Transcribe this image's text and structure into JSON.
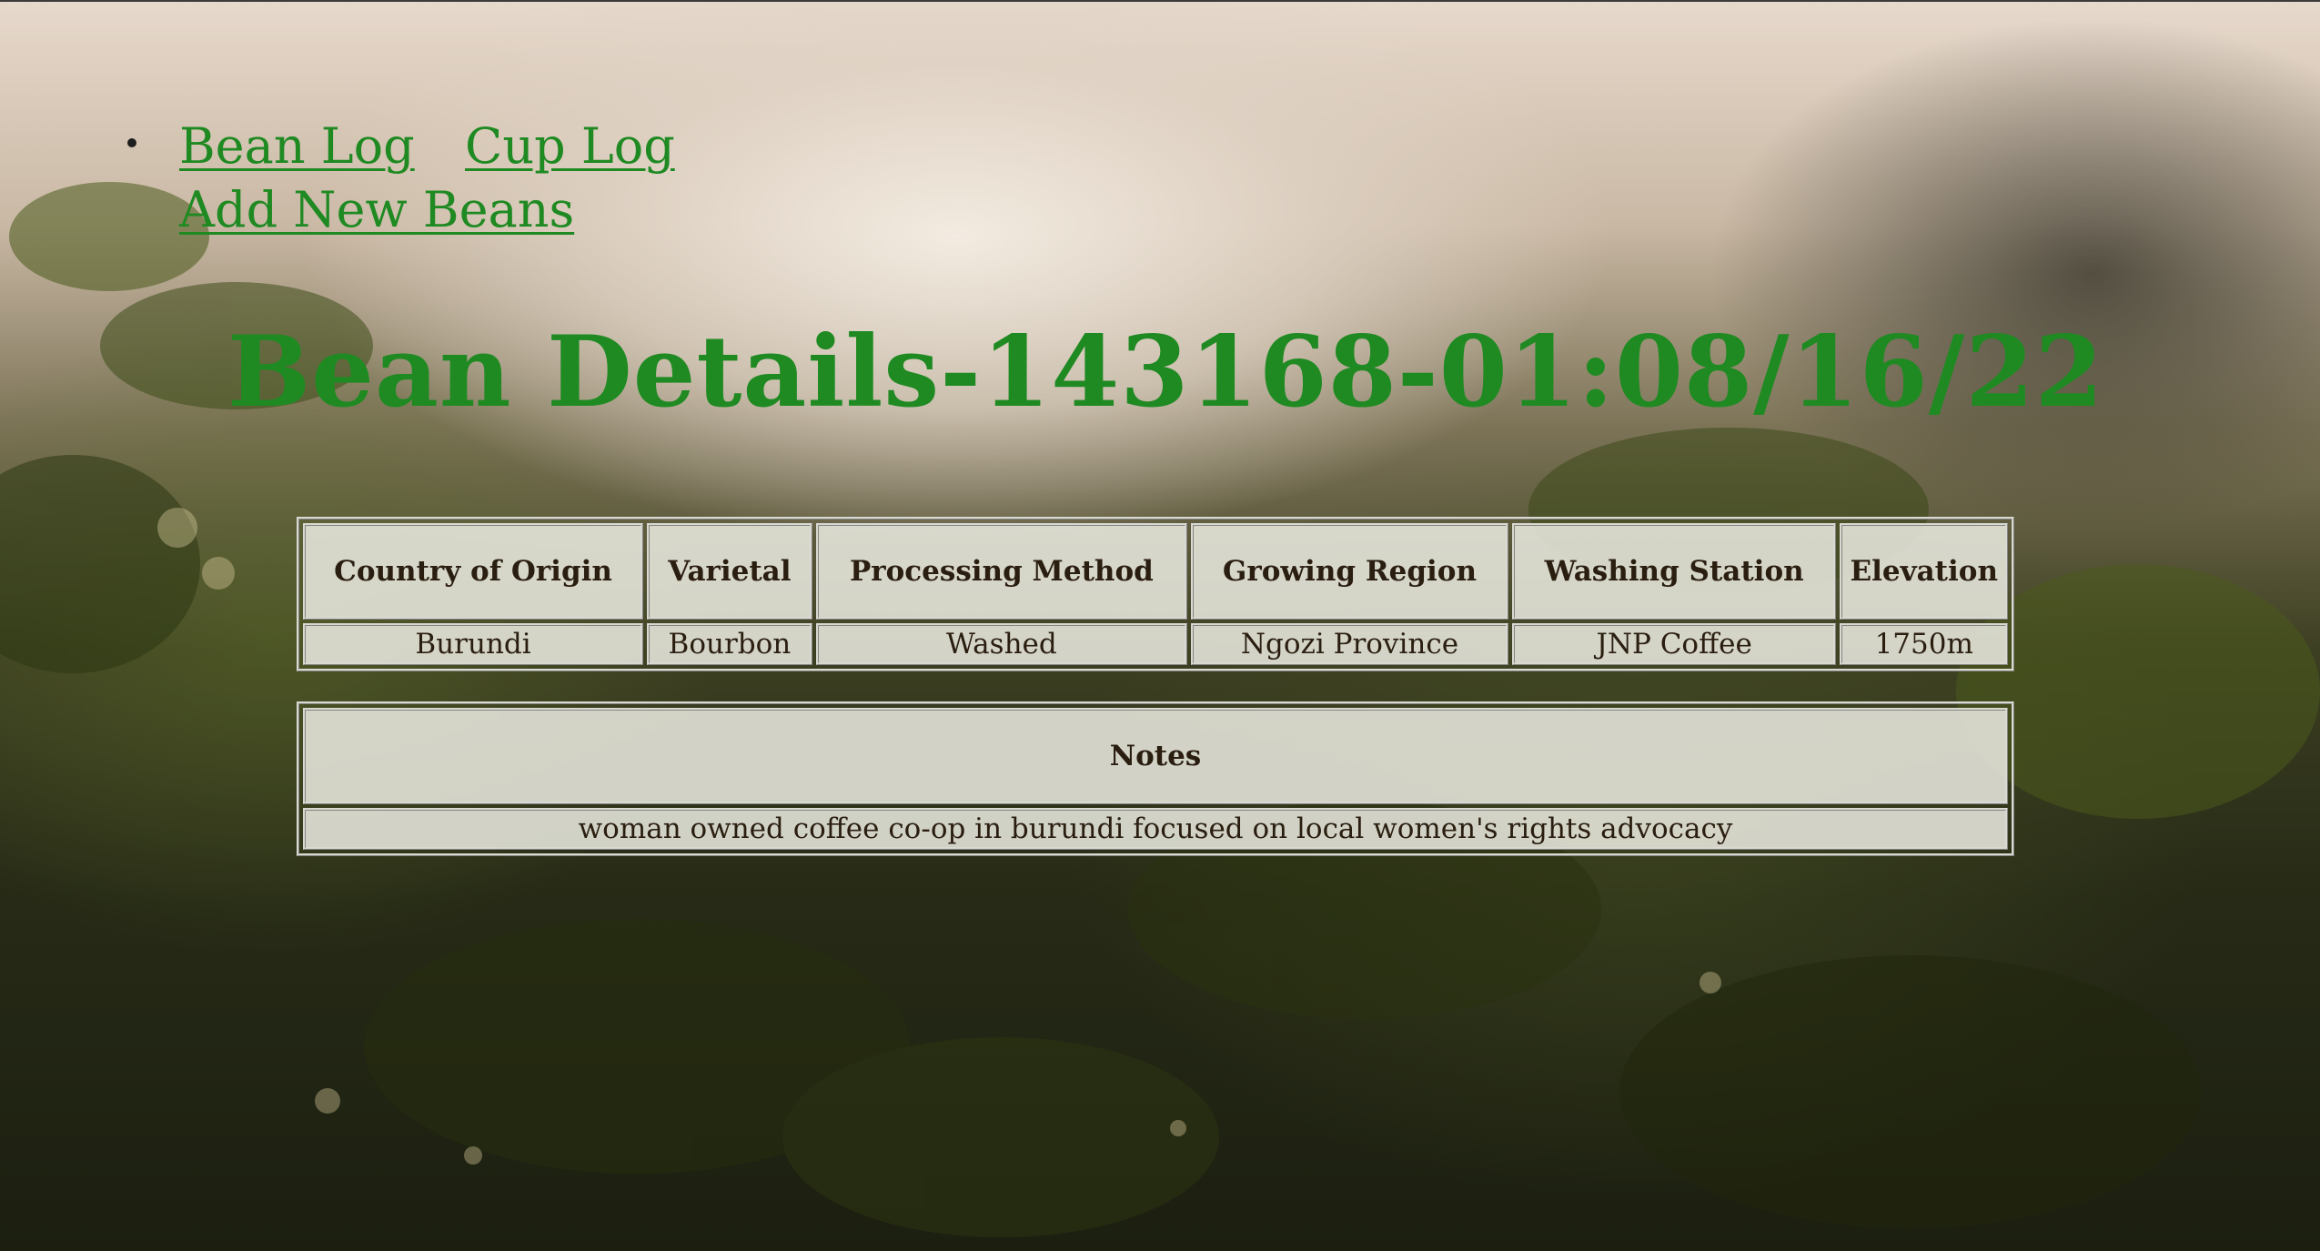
{
  "nav": {
    "items": [
      {
        "label": "Bean Log"
      },
      {
        "label": "Cup Log"
      },
      {
        "label": "Add New Beans"
      }
    ]
  },
  "page": {
    "title": "Bean Details-143168-01:08/16/22"
  },
  "details_table": {
    "headers": [
      "Country of Origin",
      "Varietal",
      "Processing Method",
      "Growing Region",
      "Washing Station",
      "Elevation"
    ],
    "row": [
      "Burundi",
      "Bourbon",
      "Washed",
      "Ngozi Province",
      "JNP Coffee",
      "1750m"
    ]
  },
  "notes_table": {
    "header": "Notes",
    "value": "woman owned coffee co-op in burundi focused on local women's rights advocacy"
  },
  "colors": {
    "link_green": "#1f8a22",
    "cell_bg": "#e8e8de",
    "text_dark": "#2a1e10"
  }
}
